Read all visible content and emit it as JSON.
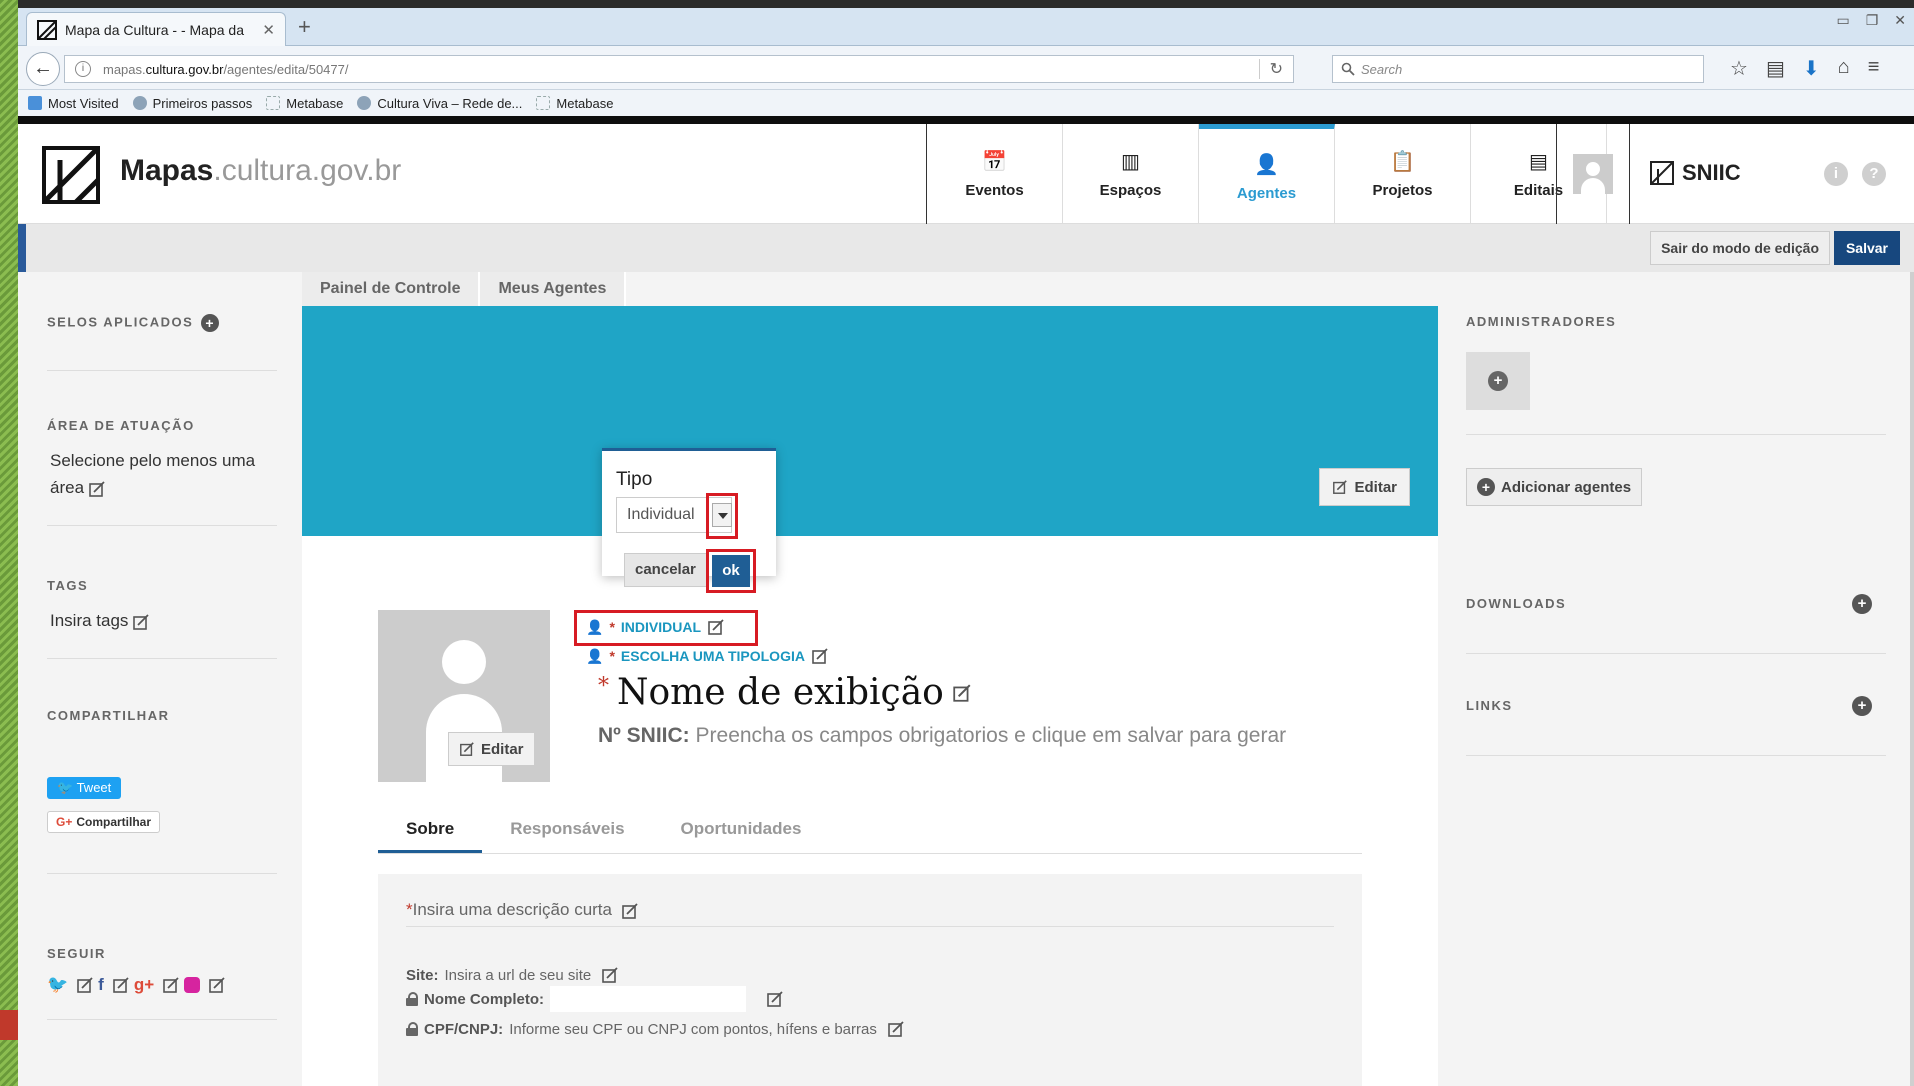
{
  "browser": {
    "tab_title": "Mapa da Cultura - - Mapa da",
    "url_prefix": "mapas.",
    "url_domain": "cultura.gov.br",
    "url_path": "/agentes/edita/50477/",
    "search_placeholder": "Search",
    "bookmarks": [
      "Most Visited",
      "Primeiros passos",
      "Metabase",
      "Cultura Viva – Rede de...",
      "Metabase"
    ]
  },
  "site": {
    "brand_bold": "Mapas",
    "brand_domain": ".cultura.gov.br",
    "nav": [
      {
        "label": "Eventos",
        "icon": "calendar-icon"
      },
      {
        "label": "Espaços",
        "icon": "building-icon"
      },
      {
        "label": "Agentes",
        "icon": "person-icon",
        "active": true
      },
      {
        "label": "Projetos",
        "icon": "clipboard-icon"
      },
      {
        "label": "Editais",
        "icon": "document-icon"
      }
    ],
    "sniic_label": "SNIIC"
  },
  "editbar": {
    "exit_label": "Sair do modo de edição",
    "save_label": "Salvar"
  },
  "breadcrumb": [
    "Painel de Controle",
    "Meus Agentes"
  ],
  "left": {
    "selos_title": "SELOS APLICADOS",
    "area_title": "ÁREA DE ATUAÇÃO",
    "area_text": "Selecione pelo menos uma área",
    "tags_title": "TAGS",
    "tags_text": "Insira tags",
    "share_title": "COMPARTILHAR",
    "tweet_label": "Tweet",
    "gplus_label": "Compartilhar",
    "follow_title": "SEGUIR"
  },
  "cover": {
    "edit_label": "Editar"
  },
  "profile": {
    "avatar_edit_label": "Editar",
    "type_label": "INDIVIDUAL",
    "typology_label": "ESCOLHA UMA TIPOLOGIA",
    "display_name": "Nome de exibição",
    "sniic_prefix": "Nº SNIIC:",
    "sniic_text": "Preencha os campos obrigatorios e clique em salvar para gerar",
    "tabs": [
      "Sobre",
      "Responsáveis",
      "Oportunidades"
    ],
    "description_placeholder": "Insira uma descrição curta",
    "site_label": "Site:",
    "site_placeholder": "Insira a url de seu site",
    "fullname_label": "Nome Completo:",
    "cpf_label": "CPF/CNPJ:",
    "cpf_placeholder": "Informe seu CPF ou CNPJ com pontos, hífens e barras"
  },
  "popup": {
    "title": "Tipo",
    "selected": "Individual",
    "cancel_label": "cancelar",
    "ok_label": "ok"
  },
  "right": {
    "admins_title": "ADMINISTRADORES",
    "add_agents_label": "Adicionar agentes",
    "downloads_title": "DOWNLOADS",
    "links_title": "LINKS"
  },
  "colors": {
    "accent": "#2b9bd1",
    "cover": "#1fa5c6",
    "primary_button": "#17477e",
    "highlight": "#d71b23"
  }
}
